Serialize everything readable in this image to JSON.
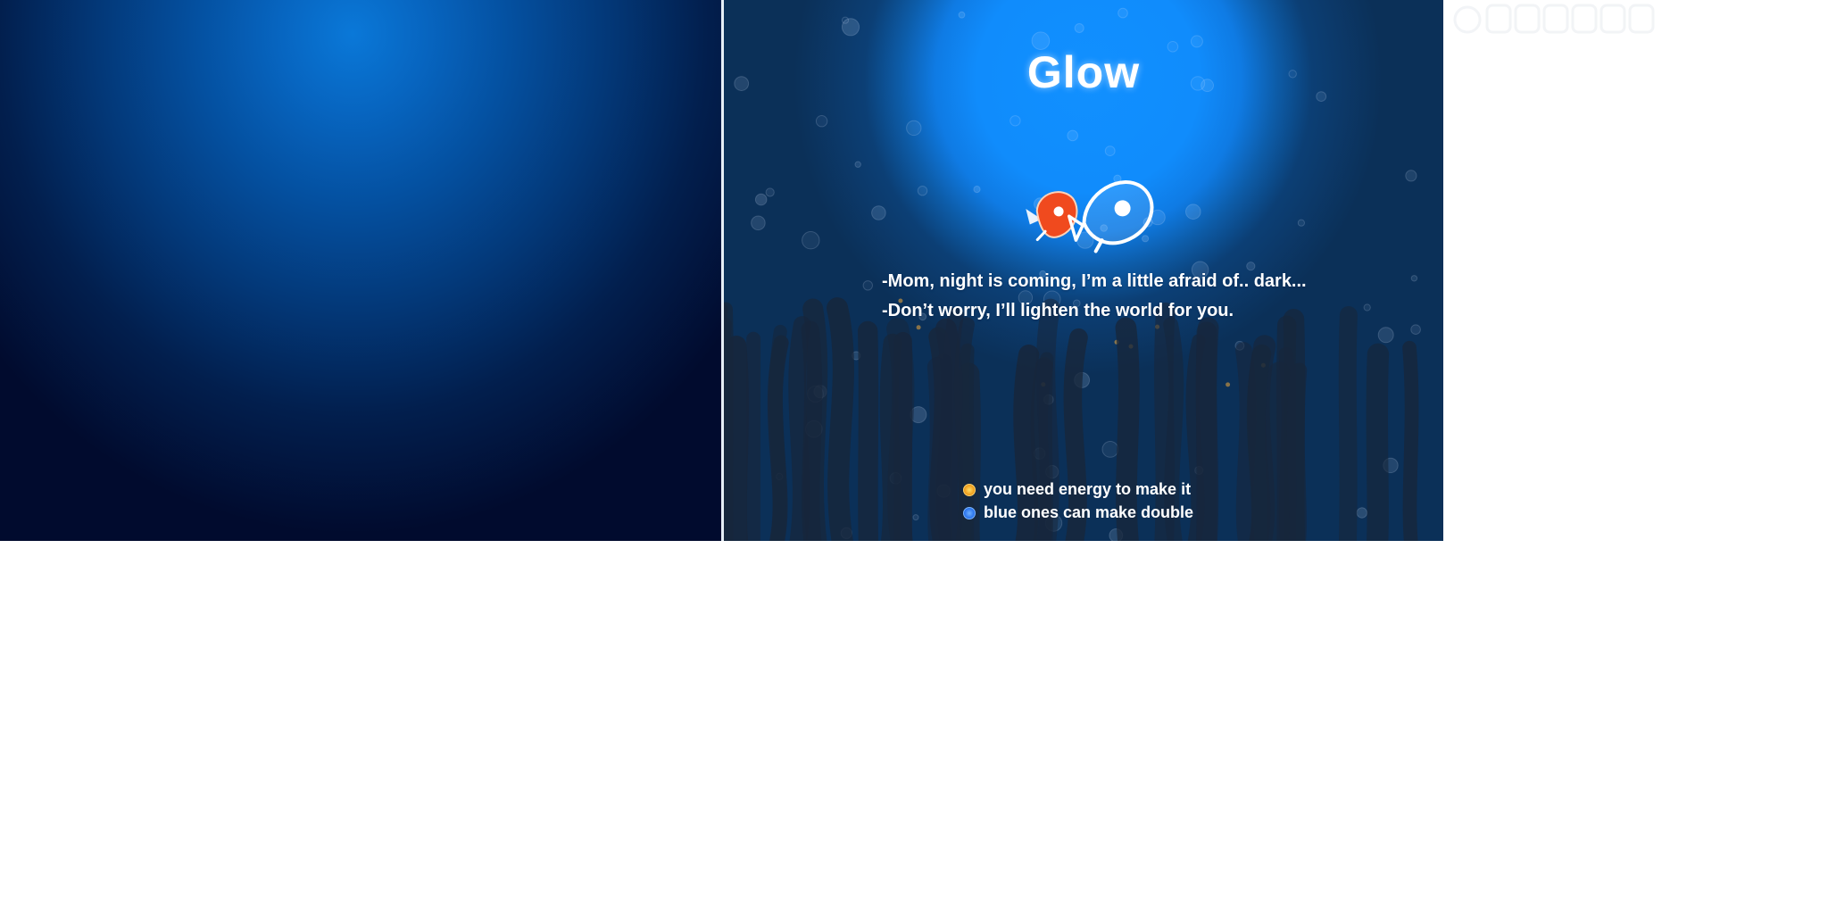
{
  "game": {
    "title": "Glow",
    "dialog": [
      "-Mom, night is coming, I’m a little afraid of.. dark...",
      "-Don’t worry, I’ll lighten the world for you."
    ],
    "legend": [
      {
        "label": "you need energy to make it",
        "dot_color": "#f3a625",
        "icon": "energy-orb-icon"
      },
      {
        "label": "blue ones can make double",
        "dot_color": "#2f78ee",
        "icon": "blue-orb-icon"
      }
    ],
    "characters": [
      "baby-fish-icon",
      "mother-fish-icon"
    ]
  },
  "colors": {
    "moon_glow": "#1190ff",
    "night_sky": "#0b3058",
    "baby_fish": "#f04a1e",
    "left_panel": "#0a78d8"
  }
}
